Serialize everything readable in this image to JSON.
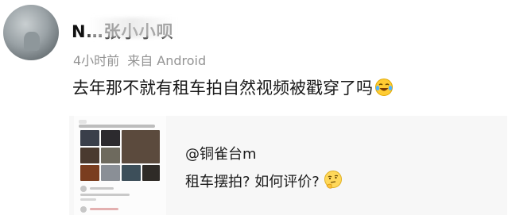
{
  "post": {
    "username": "N…张小小呗",
    "time": "4小时前",
    "source": "来自 Android",
    "text": "去年那不就有租车拍自然视频被戳穿了吗",
    "text_emoji": "laughing-with-tears-icon"
  },
  "card": {
    "mention": "@铜雀台m",
    "text": "租车摆拍? 如何评价?",
    "text_emoji": "thinking-face-icon"
  },
  "colors": {
    "meta_gray": "#939393",
    "card_bg": "#f7f7f7",
    "text": "#1a1a1a"
  }
}
